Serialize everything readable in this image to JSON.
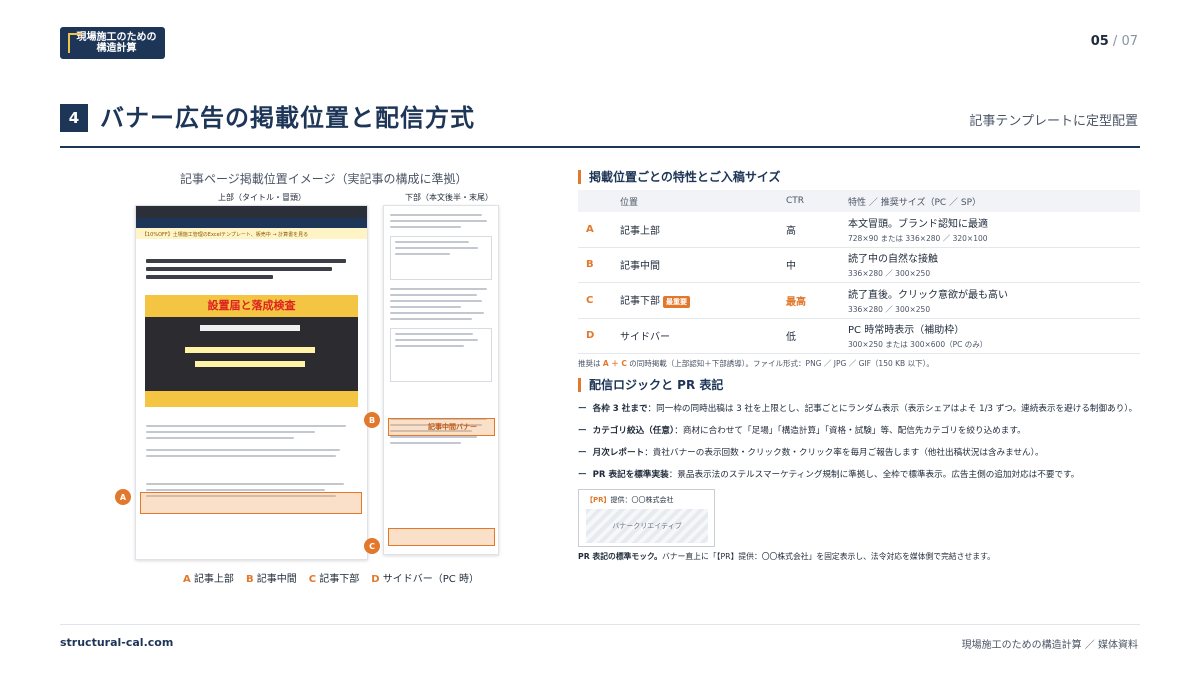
{
  "header": {
    "logo_text": "現場施工のための\n構造計算",
    "page_current": "05",
    "page_sep": " / ",
    "page_total": "07",
    "section_number": "4",
    "title": "バナー広告の掲載位置と配信方式",
    "right_note": "記事テンプレートに定型配置"
  },
  "mockup": {
    "caption": "記事ページ掲載位置イメージ（実記事の構成に準拠）",
    "label_top": "上部（タイトル・冒頭）",
    "label_bottom": "下部（本文後半・末尾）",
    "promo_text": "【10%OFF】土場施工管理のExcelテンプレート、販売中 → 計算書を見る",
    "hero_title": "設置届と落成検査",
    "slot_b_text": "記事中間バナー",
    "legend": [
      {
        "letter": "A",
        "text": "記事上部"
      },
      {
        "letter": "B",
        "text": "記事中間"
      },
      {
        "letter": "C",
        "text": "記事下部"
      },
      {
        "letter": "D",
        "text": "サイドバー（PC 時）"
      }
    ],
    "markers": {
      "a": "A",
      "b": "B",
      "c": "C"
    }
  },
  "section1": {
    "title": "掲載位置ごとの特性とご入稿サイズ",
    "headers": {
      "pos": "位置",
      "ctr": "CTR",
      "spec": "特性 ／ 推奨サイズ（PC ／ SP）"
    },
    "rows": [
      {
        "id": "A",
        "pos": "記事上部",
        "tag": "",
        "ctr": "高",
        "feature": "本文冒頭。ブランド認知に最適",
        "size": "728×90 または 336×280 ／ 320×100"
      },
      {
        "id": "B",
        "pos": "記事中間",
        "tag": "",
        "ctr": "中",
        "feature": "読了中の自然な接触",
        "size": "336×280 ／ 300×250"
      },
      {
        "id": "C",
        "pos": "記事下部",
        "tag": "最重要",
        "ctr": "最高",
        "feature": "読了直後。クリック意欲が最も高い",
        "size": "336×280 ／ 300×250"
      },
      {
        "id": "D",
        "pos": "サイドバー",
        "tag": "",
        "ctr": "低",
        "feature": "PC 時常時表示（補助枠）",
        "size": "300×250 または 300×600（PC のみ）"
      }
    ],
    "note_prefix": "推奨は ",
    "note_highlight": "A ＋ C",
    "note_suffix": " の同時掲載（上部認知＋下部誘導）。ファイル形式：PNG ／ JPG ／ GIF（150 KB 以下）。"
  },
  "section2": {
    "title": "配信ロジックと PR 表記",
    "items": [
      {
        "label": "各枠 3 社まで",
        "text": "：同一枠の同時出稿は 3 社を上限とし、記事ごとにランダム表示（表示シェアはよそ 1/3 ずつ。連続表示を避ける制御あり）。"
      },
      {
        "label": "カテゴリ絞込（任意）",
        "text": "：商材に合わせて「足場」「構造計算」「資格・試験」等、配信先カテゴリを絞り込めます。"
      },
      {
        "label": "月次レポート",
        "text": "：貴社バナーの表示回数・クリック数・クリック率を毎月ご報告します（他社出稿状況は含みません）。"
      },
      {
        "label": "PR 表記を標準実装",
        "text": "：景品表示法のステルスマーケティング規制に準拠し、全枠で標準表示。広告主側の追加対応は不要です。"
      }
    ],
    "mock_pr": "【PR】",
    "mock_provider": "提供：〇〇株式会社",
    "mock_creative": "バナークリエイティブ",
    "mock_caption_bold": "PR 表記の標準モック。",
    "mock_caption": "バナー直上に「【PR】提供：〇〇株式会社」を固定表示し、法令対応を媒体側で完結させます。"
  },
  "footer": {
    "site": "structural-cal.com",
    "right": "現場施工のための構造計算 ／ 媒体資料"
  },
  "colors": {
    "navy": "#1d3557",
    "accent": "#e2782b"
  }
}
